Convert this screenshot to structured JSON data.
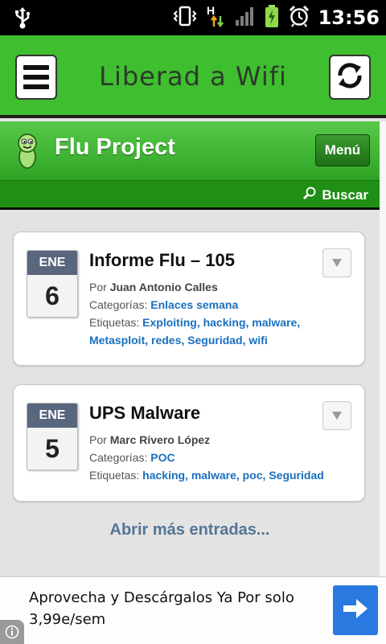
{
  "status_bar": {
    "time": "13:56",
    "icons": [
      "usb-icon",
      "vibrate-icon",
      "hspa-data-icon",
      "signal-icon",
      "battery-charging-icon",
      "alarm-icon"
    ]
  },
  "app_bar": {
    "title": "Liberad a Wifi",
    "menu_icon": "hamburger-icon",
    "refresh_icon": "refresh-icon"
  },
  "site": {
    "title": "Flu Project",
    "menu_label": "Menú",
    "search_label": "Buscar"
  },
  "posts": [
    {
      "month": "ENE",
      "day": "6",
      "title": "Informe Flu – 105",
      "author_prefix": "Por",
      "author": "Juan Antonio Calles",
      "categories_label": "Categorías:",
      "categories": "Enlaces semana",
      "tags_label": "Etiquetas:",
      "tags_line1": "Exploiting, hacking, malware,",
      "tags_line2": "Metasploit, redes, Seguridad, wifi"
    },
    {
      "month": "ENE",
      "day": "5",
      "title": "UPS Malware",
      "author_prefix": "Por",
      "author": "Marc Rivero López",
      "categories_label": "Categorías:",
      "categories": "POC",
      "tags_label": "Etiquetas:",
      "tags_line1": "hacking, malware, poc, Seguridad"
    }
  ],
  "more_link": "Abrir más entradas...",
  "ad": {
    "text": "Aprovecha y Descárgalos Ya Por solo 3,99e/sem",
    "button_icon": "arrow-right-icon",
    "info_icon": "info-icon"
  },
  "colors": {
    "brand_green": "#3fbe2f",
    "dark_green": "#1f8f15",
    "link_blue": "#1a6fbf",
    "date_header": "#58667e",
    "ad_button": "#2a79e0"
  }
}
